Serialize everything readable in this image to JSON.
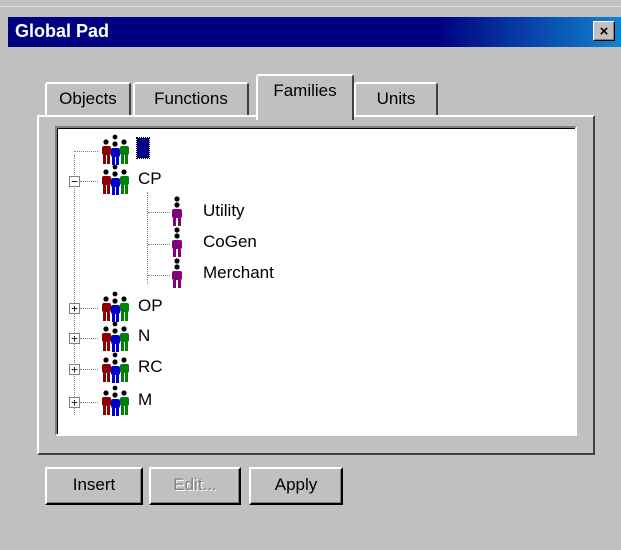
{
  "window": {
    "title": "Global Pad",
    "close_glyph": "×",
    "titlebar_colors": [
      "#000080",
      "#1084d0"
    ]
  },
  "tabs": [
    {
      "label": "Objects",
      "active": false
    },
    {
      "label": "Functions",
      "active": false
    },
    {
      "label": "Families",
      "active": true
    },
    {
      "label": "Units",
      "active": false
    }
  ],
  "tree": {
    "root": {
      "label": "",
      "icon": "family-group-icon",
      "selected": true
    },
    "nodes": [
      {
        "label": "CP",
        "expanded": true,
        "icon": "family-group-icon",
        "expander": "−",
        "children": [
          {
            "label": "Utility",
            "icon": "person-icon"
          },
          {
            "label": "CoGen",
            "icon": "person-icon"
          },
          {
            "label": "Merchant",
            "icon": "person-icon"
          }
        ]
      },
      {
        "label": "OP",
        "expanded": false,
        "icon": "family-group-icon",
        "expander": "+"
      },
      {
        "label": "N",
        "expanded": false,
        "icon": "family-group-icon",
        "expander": "+"
      },
      {
        "label": "RC",
        "expanded": false,
        "icon": "family-group-icon",
        "expander": "+"
      },
      {
        "label": "M",
        "expanded": false,
        "icon": "family-group-icon",
        "expander": "+"
      }
    ]
  },
  "buttons": {
    "insert": "Insert",
    "edit": "Edit...",
    "apply": "Apply"
  },
  "colors": {
    "family_red": "#8b0000",
    "family_blue": "#0000cc",
    "family_green": "#008000",
    "person_purple": "#800080"
  }
}
